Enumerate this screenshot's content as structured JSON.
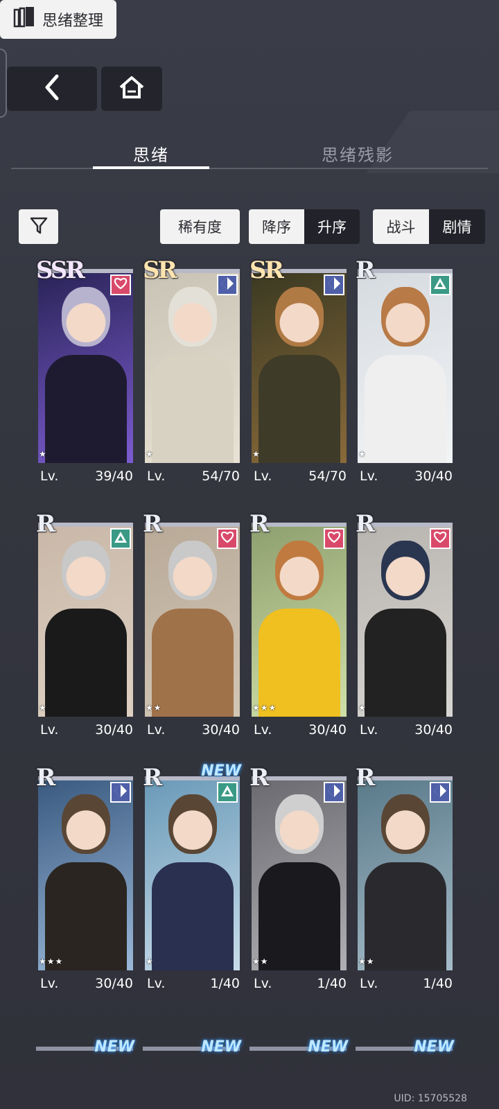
{
  "header": {
    "back_icon": "chevron-left-icon",
    "home_icon": "home-icon",
    "arrange_label": "思绪整理",
    "arrange_icon": "cards-stack-icon"
  },
  "tabs": [
    {
      "label": "思绪",
      "active": true
    },
    {
      "label": "思绪残影",
      "active": false
    }
  ],
  "controls": {
    "filter_icon": "filter-icon",
    "rarity_label": "稀有度",
    "order": {
      "desc": "降序",
      "asc": "升序",
      "selected": "desc"
    },
    "mode": {
      "battle": "战斗",
      "story": "剧情",
      "selected": "battle"
    }
  },
  "level_label": "Lv.",
  "cards": [
    {
      "rarity": "SSR",
      "badge": "heart",
      "stars": 1,
      "level": "39/40",
      "new": false
    },
    {
      "rarity": "SR",
      "badge": "diamond",
      "stars": 1,
      "level": "54/70",
      "new": false
    },
    {
      "rarity": "SR",
      "badge": "diamond",
      "stars": 1,
      "level": "54/70",
      "new": false
    },
    {
      "rarity": "R",
      "badge": "triangle",
      "stars": 1,
      "level": "30/40",
      "new": false
    },
    {
      "rarity": "R",
      "badge": "triangle",
      "stars": 1,
      "level": "30/40",
      "new": false
    },
    {
      "rarity": "R",
      "badge": "heart",
      "stars": 2,
      "level": "30/40",
      "new": false
    },
    {
      "rarity": "R",
      "badge": "heart",
      "stars": 3,
      "level": "30/40",
      "new": false
    },
    {
      "rarity": "R",
      "badge": "heart",
      "stars": 1,
      "level": "30/40",
      "new": false
    },
    {
      "rarity": "R",
      "badge": "diamond",
      "stars": 3,
      "level": "30/40",
      "new": false
    },
    {
      "rarity": "R",
      "badge": "triangle",
      "stars": 1,
      "level": "1/40",
      "new": true
    },
    {
      "rarity": "R",
      "badge": "diamond",
      "stars": 2,
      "level": "1/40",
      "new": false
    },
    {
      "rarity": "R",
      "badge": "diamond",
      "stars": 2,
      "level": "1/40",
      "new": false
    }
  ],
  "new_label": "NEW",
  "peek_row_new": [
    true,
    true,
    true,
    true
  ],
  "uid": "UID: 15705528",
  "colors": {
    "heart": "#d94a6a",
    "diamond": "#4f5fa8",
    "triangle": "#3a9a86"
  }
}
